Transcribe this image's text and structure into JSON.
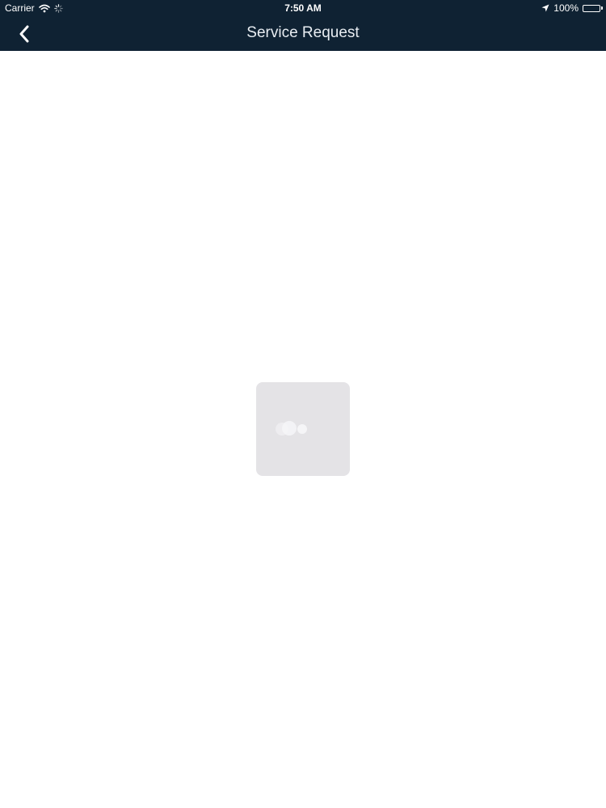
{
  "status_bar": {
    "carrier": "Carrier",
    "time": "7:50 AM",
    "battery": "100%",
    "icons": [
      "wifi-icon",
      "activity-spinner-icon",
      "location-arrow-icon",
      "battery-icon"
    ]
  },
  "nav": {
    "title": "Service Request",
    "back_icon": "chevron-left-icon"
  },
  "loading": {
    "icon": "loading-spinner-icon"
  },
  "colors": {
    "nav_background": "#0f2233",
    "nav_text": "#e8edf2",
    "page_background": "#ffffff",
    "loader_background": "#e4e3e6"
  }
}
